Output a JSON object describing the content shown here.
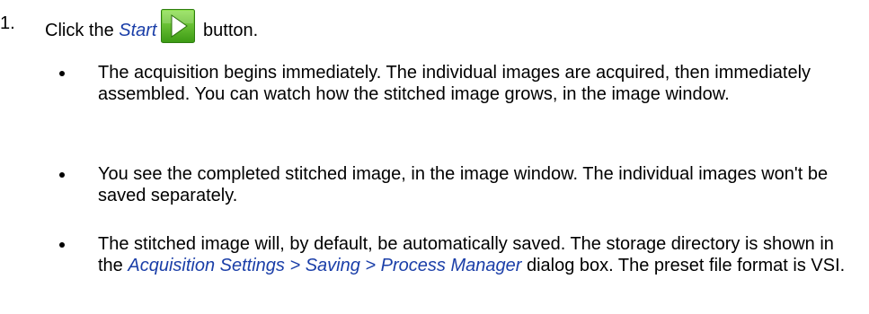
{
  "step": {
    "number": "1.",
    "prefix": "Click the ",
    "button_term": "Start",
    "suffix": " button.",
    "button_icon": "play-icon",
    "button_colors": {
      "background_top": "#7fd640",
      "background_bottom": "#3c9a14",
      "border": "#2e7d10",
      "triangle": "#ffffff"
    }
  },
  "bullets": [
    {
      "text": "The acquisition begins immediately. The individual images are acquired, then immediately assembled. You can watch how the stitched image grows, in the image window."
    },
    {
      "text": "You see the completed stitched image, in the image window. The individual images won't be saved separately."
    },
    {
      "before": "The stitched image will, by default, be automatically saved. The storage directory is shown in the ",
      "path": "Acquisition Settings > Saving > Process Manager",
      "after": " dialog box. The preset file format is VSI."
    }
  ],
  "colors": {
    "ui_term": "#1a3ea8",
    "text": "#000000",
    "background": "#ffffff"
  }
}
